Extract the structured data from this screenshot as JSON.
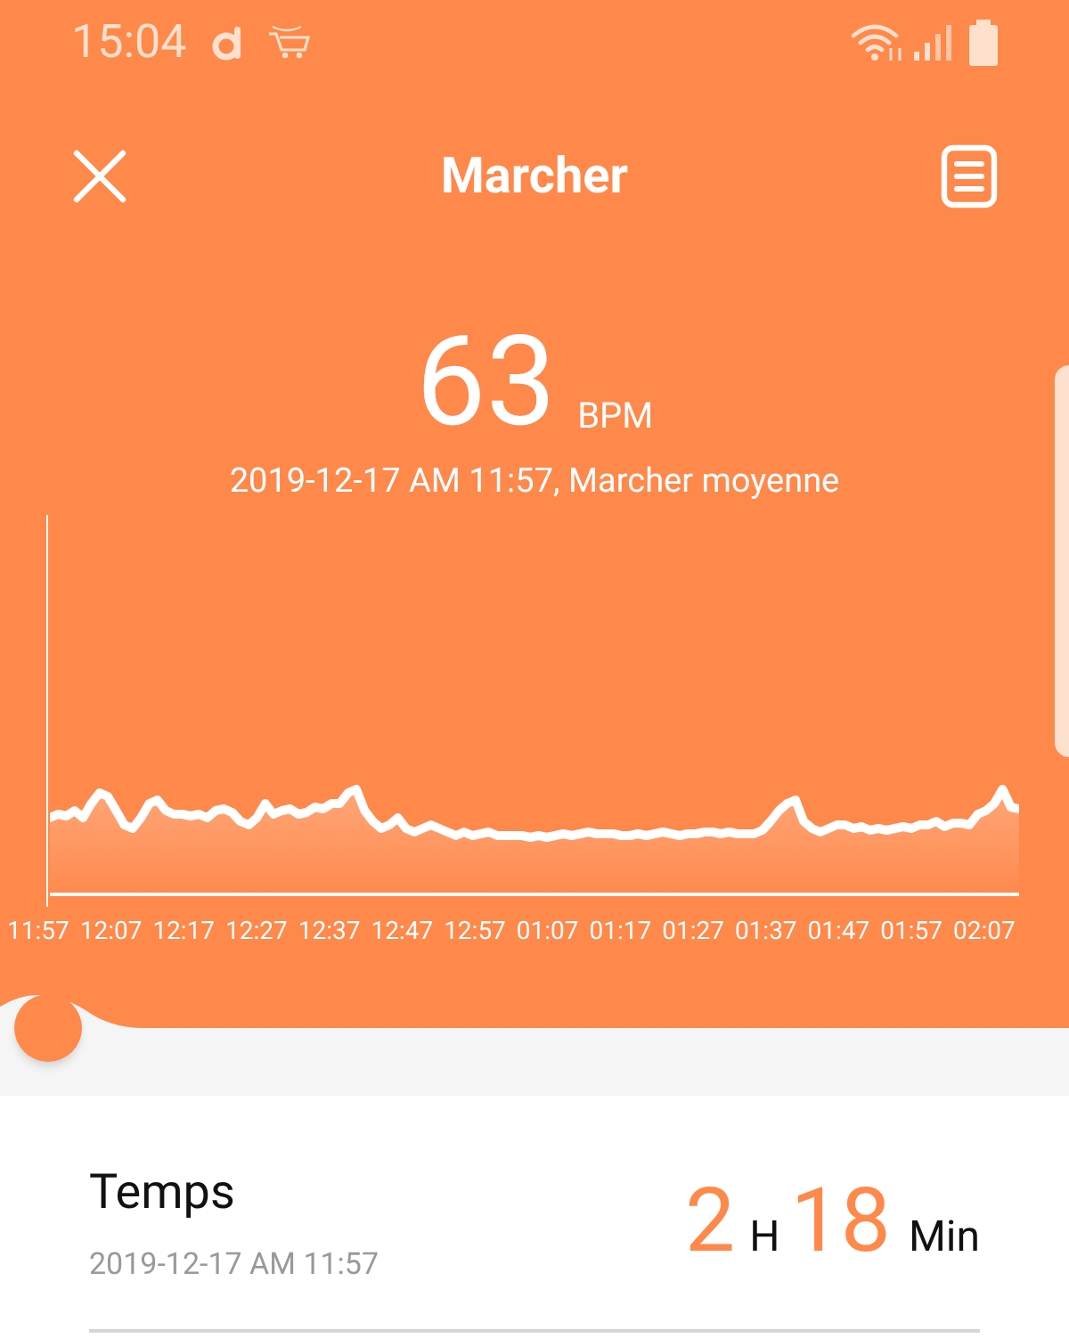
{
  "status_bar": {
    "time": "15:04"
  },
  "header": {
    "title": "Marcher"
  },
  "reading": {
    "value": "63",
    "unit": "BPM",
    "caption": "2019-12-17 AM 11:57, Marcher moyenne"
  },
  "chart": {
    "x_labels": [
      "11:57",
      "12:07",
      "12:17",
      "12:27",
      "12:37",
      "12:47",
      "12:57",
      "01:07",
      "01:17",
      "01:27",
      "01:37",
      "01:47",
      "01:57",
      "02:07"
    ]
  },
  "scrubber": {
    "level": 0
  },
  "summary": {
    "label": "Temps",
    "date": "2019-12-17 AM 11:57",
    "hours": "2",
    "hours_unit": "H",
    "minutes": "18",
    "minutes_unit": "Min"
  }
}
